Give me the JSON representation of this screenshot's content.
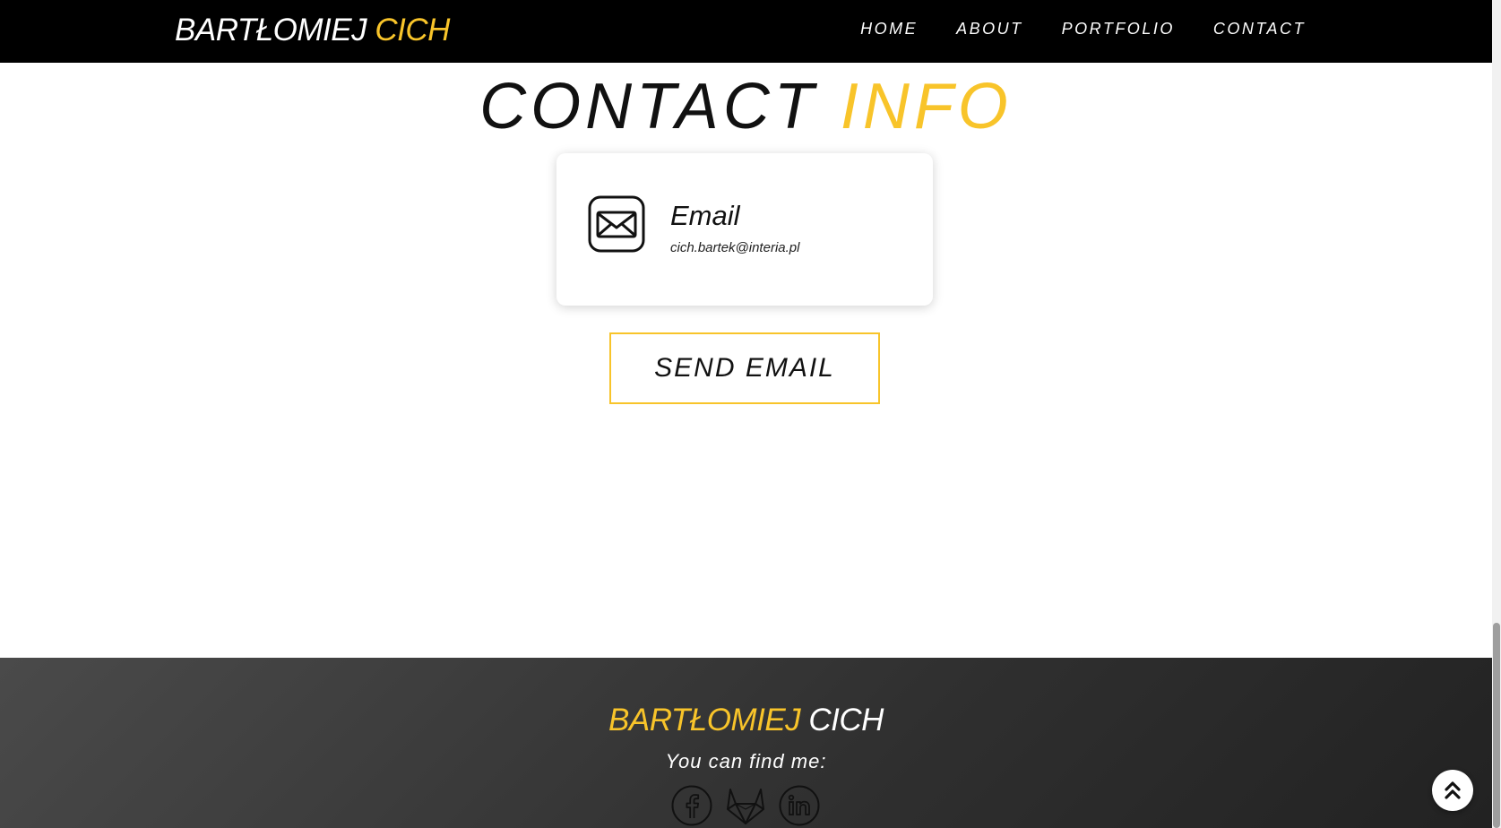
{
  "nav": {
    "brand_first": "BARTŁOMIEJ",
    "brand_second": "CICH",
    "links": [
      {
        "label": "HOME"
      },
      {
        "label": "ABOUT"
      },
      {
        "label": "PORTFOLIO"
      },
      {
        "label": "CONTACT"
      }
    ]
  },
  "contact": {
    "title_first": "CONTACT",
    "title_second": "INFO",
    "card": {
      "icon": "envelope-icon",
      "title": "Email",
      "value": "cich.bartek@interia.pl"
    },
    "send_button": "SEND EMAIL"
  },
  "footer": {
    "brand_first": "BARTŁOMIEJ",
    "brand_second": "CICH",
    "tagline": "You can find me:",
    "social": [
      {
        "icon": "facebook-icon"
      },
      {
        "icon": "gitlab-icon"
      },
      {
        "icon": "linkedin-icon"
      }
    ]
  },
  "scroll_top": {
    "icon": "double-chevron-up-icon"
  },
  "colors": {
    "accent": "#f8c42a",
    "navbar": "#000000",
    "footer": "#333333"
  }
}
